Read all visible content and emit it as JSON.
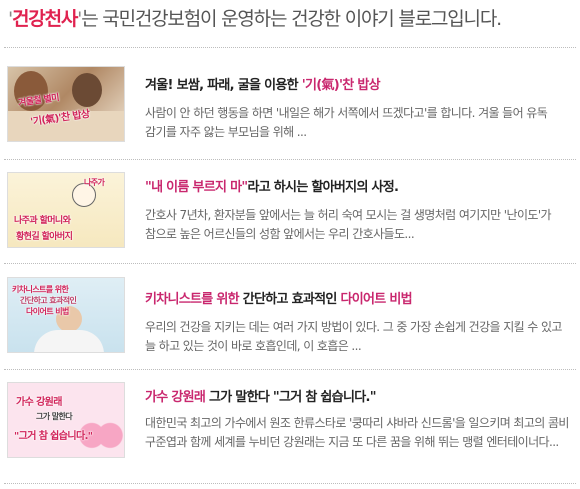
{
  "header": {
    "open_quote": "'",
    "brand": "건강천사",
    "close_quote": "'",
    "tagline": "는 국민건강보험이 운영하는 건강한 이야기 블로그입니다."
  },
  "posts": [
    {
      "thumb_lines": [
        "겨울철 별미",
        "'기(氣)'찬 밥상"
      ],
      "title_pre": "겨울! 보쌈, 파래, 굴을 이용한 ",
      "title_hl": "'기(氣)'찬 밥상",
      "title_post": "",
      "excerpt": "사람이 안 하던 행동을 하면 '내일은 해가 서쪽에서 뜨겠다고'를 합니다. 겨울 들어 유독 감기를 자주 앓는 부모님을 위해 ..."
    },
    {
      "thumb_lines": [
        "나주가",
        "나주과 할머니와",
        "황현길 할아버지"
      ],
      "title_pre": "",
      "title_hl": "\"내 이름 부르지 마\"",
      "title_post": "라고 하시는 할아버지의 사정.",
      "excerpt": "간호사 7년차, 환자분들 앞에서는 늘 허리 숙여 모시는 걸 생명처럼 여기지만 '난이도'가 참으로 높은 어르신들의 성함 앞에서는 우리 간호사들도..."
    },
    {
      "thumb_lines": [
        "키차니스트를 위한",
        "간단하고 효과적인",
        "다이어트 비법"
      ],
      "title_pre": "",
      "title_hl": "키차니스트를 위한",
      "title_mid": " 간단하고 효과적인 ",
      "title_hl2": "다이어트 비법",
      "title_post": "",
      "excerpt": "우리의 건강을 지키는 데는 여러 가지 방법이 있다. 그 중 가장 손쉽게 건강을 지킬 수 있고 늘 하고 있는 것이 바로 호흡인데, 이 호흡은 ..."
    },
    {
      "thumb_lines": [
        "가수 강원래",
        "그가 말한다",
        "\"그거 참 쉽습니다.\""
      ],
      "title_pre": "",
      "title_hl": "가수 강원래",
      "title_post": " 그가 말한다 \"그거 참 쉽습니다.\"",
      "excerpt": "대한민국 최고의 가수에서 원조 한류스타로 '쿵따리 샤바라 신드롬'을 일으키며 최고의 콤비 구준엽과 함께 세계를 누비던 강원래는 지금 또 다른 꿈을 위해 뛰는 맹렬 엔터테이너다..."
    }
  ],
  "colors": {
    "brand": "#e0224f",
    "title_highlight": "#c9276e",
    "excerpt": "#666666",
    "separator": "#bdbdbd"
  }
}
